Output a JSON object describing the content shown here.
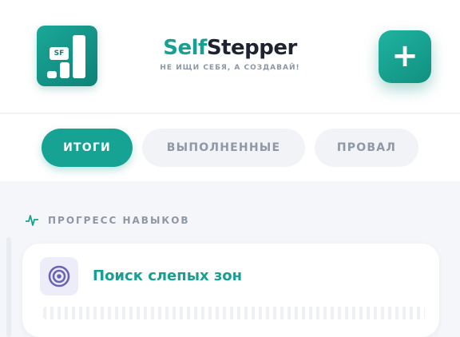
{
  "header": {
    "logo_text": "SF",
    "brand_part1": "Self",
    "brand_part2": "Stepper",
    "tagline": "НЕ ИЩИ СЕБЯ, А СОЗДАВАЙ!",
    "add_label": "+"
  },
  "tabs": [
    {
      "label": "ИТОГИ",
      "active": true
    },
    {
      "label": "ВЫПОЛНЕННЫЕ",
      "active": false
    },
    {
      "label": "ПРОВАЛ",
      "active": false
    }
  ],
  "progress": {
    "section_title": "ПРОГРЕСС НАВЫКОВ",
    "section_icon": "pulse-icon",
    "skills": [
      {
        "name": "Поиск слепых зон",
        "icon": "target-icon"
      }
    ]
  },
  "colors": {
    "accent": "#17a091",
    "dark_text": "#1d2330",
    "muted_text": "#8e97a5",
    "target_purple": "#6a63b8"
  }
}
